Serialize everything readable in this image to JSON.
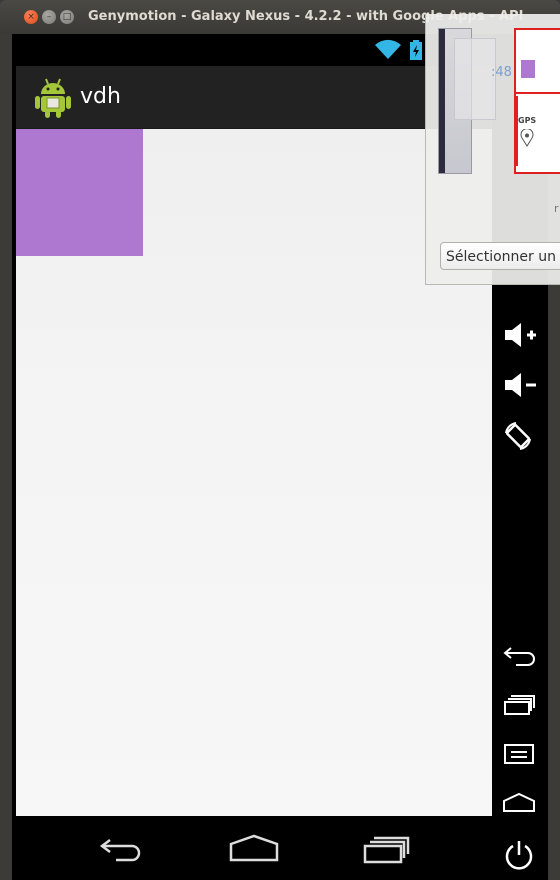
{
  "window": {
    "title": "Genymotion - Galaxy Nexus - 4.2.2 - with Google Apps - API"
  },
  "statusbar": {
    "icons": [
      "wifi-icon",
      "battery-icon"
    ]
  },
  "actionbar": {
    "app_title": "vdh",
    "app_icon": "android-robot-icon"
  },
  "content": {
    "view_color": "#ae77d0"
  },
  "navbar": {
    "buttons": [
      "back-icon",
      "home-icon",
      "recent-apps-icon"
    ]
  },
  "sidebar": {
    "buttons": [
      "volume-up-icon",
      "volume-down-icon",
      "rotate-icon",
      "back-icon",
      "recent-apps-icon",
      "menu-icon",
      "home-icon",
      "power-icon"
    ]
  },
  "overlay": {
    "clock_text": ":48",
    "gps_label": "GPS",
    "select_placeholder": "Sélectionner un",
    "partial_text": "r"
  },
  "colors": {
    "accent_purple": "#ae77d0",
    "actionbar_bg": "#222222",
    "ubuntu_close": "#dd4814"
  }
}
